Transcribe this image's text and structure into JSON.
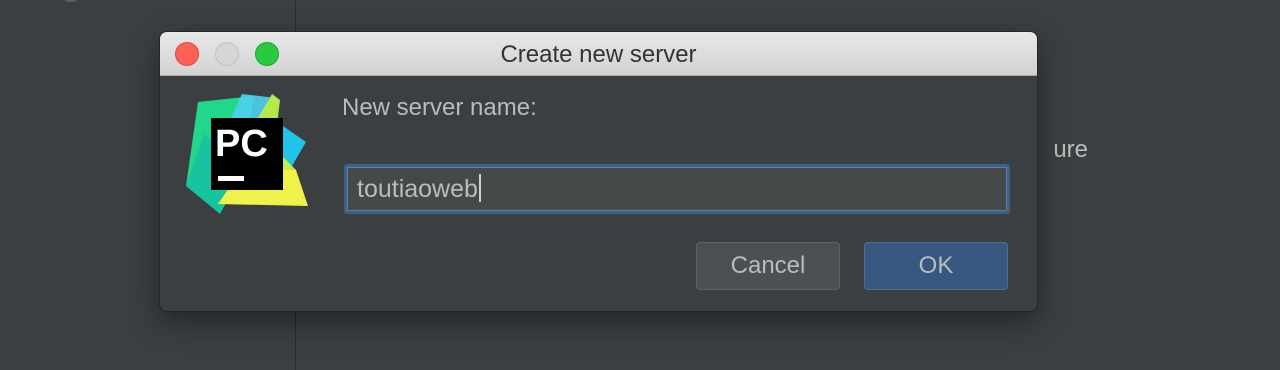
{
  "background": {
    "partial_text": "ure"
  },
  "dialog": {
    "title": "Create new server",
    "prompt_label": "New server name:",
    "input_value": "toutiaoweb",
    "cancel_label": "Cancel",
    "ok_label": "OK",
    "logo_text": "PC"
  },
  "colors": {
    "dialog_bg": "#3c3f41",
    "titlebar": "#d6d6d6",
    "input_border": "#3d6185",
    "ok_button": "#365880",
    "cancel_button": "#4c5052",
    "close_light": "#fe5f57",
    "minimize_light": "#d6d6d6",
    "zoom_light": "#29c940"
  }
}
